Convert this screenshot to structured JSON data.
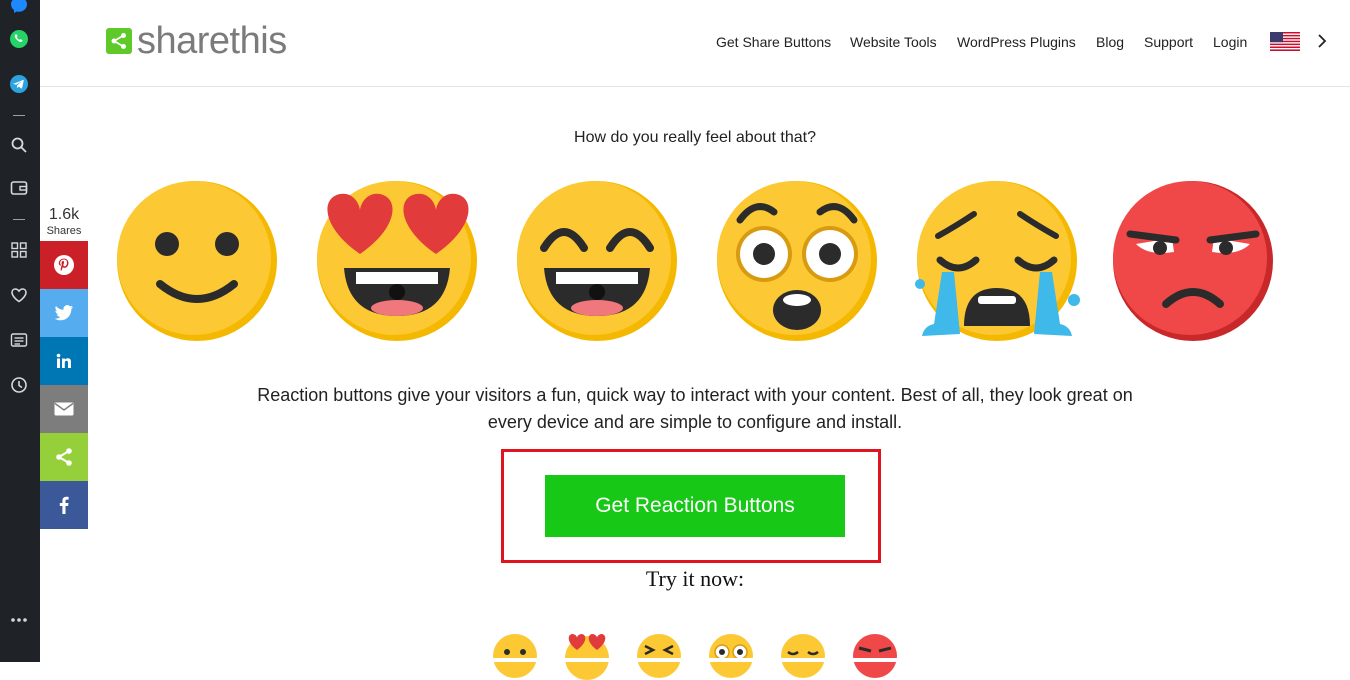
{
  "header": {
    "logo_text": "sharethis",
    "nav": [
      {
        "label": "Get Share Buttons"
      },
      {
        "label": "Website Tools"
      },
      {
        "label": "WordPress Plugins"
      },
      {
        "label": "Blog"
      },
      {
        "label": "Support"
      },
      {
        "label": "Login"
      }
    ],
    "flag_icon": "us-flag-icon",
    "more_icon": "chevron-right-icon"
  },
  "main": {
    "question": "How do you really feel about that?",
    "reactions": [
      "slight-smile",
      "heart-eyes",
      "laughing",
      "astonished",
      "crying",
      "angry"
    ],
    "description": "Reaction buttons give your visitors a fun, quick way to interact with your content. Best of all, they look great on every device and are simple to configure and install.",
    "cta_label": "Get Reaction Buttons",
    "try_now": "Try it now:"
  },
  "share_bar": {
    "count": "1.6k",
    "count_label": "Shares",
    "buttons": [
      {
        "name": "pinterest",
        "color": "#cb2027"
      },
      {
        "name": "twitter",
        "color": "#55acee"
      },
      {
        "name": "linkedin",
        "color": "#0077b5"
      },
      {
        "name": "email",
        "color": "#7d7d7d"
      },
      {
        "name": "sharethis",
        "color": "#95d03a"
      },
      {
        "name": "facebook",
        "color": "#3b5998"
      }
    ]
  },
  "browser_rail": {
    "icons": [
      "messenger-icon",
      "whatsapp-icon",
      "telegram-icon",
      "search-icon",
      "wallet-icon",
      "apps-icon",
      "heart-icon",
      "news-icon",
      "history-icon",
      "more-icon"
    ]
  },
  "colors": {
    "brand_green": "#5ec928",
    "cta_green": "#17c817",
    "highlight_red": "#e0141e"
  }
}
